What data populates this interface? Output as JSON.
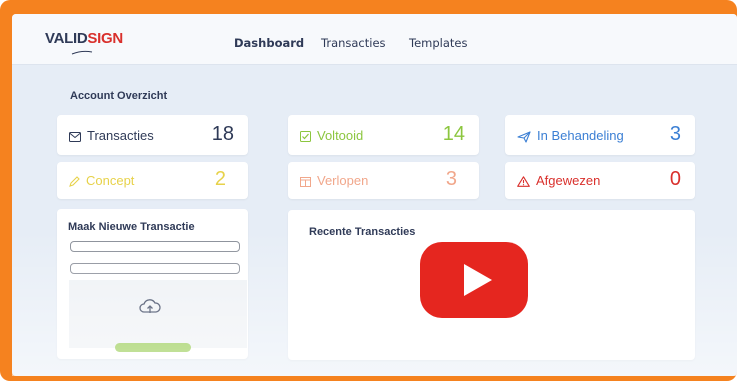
{
  "app": {
    "logo_left": "VALID",
    "logo_right": "SIGN"
  },
  "nav": {
    "items": [
      {
        "label": "Dashboard",
        "active": true
      },
      {
        "label": "Transacties",
        "active": false
      },
      {
        "label": "Templates",
        "active": false
      }
    ]
  },
  "overview": {
    "title": "Account Overzicht",
    "stats": [
      {
        "label": "Transacties",
        "value": "18",
        "icon": "envelope-icon",
        "color": "#2f3a57",
        "num_color": "#2f3a57"
      },
      {
        "label": "Voltooid",
        "value": "14",
        "icon": "check-square-icon",
        "color": "#8cc63f",
        "num_color": "#8cc63f"
      },
      {
        "label": "In Behandeling",
        "value": "3",
        "icon": "send-icon",
        "color": "#3b7fd4",
        "num_color": "#3b7fd4"
      },
      {
        "label": "Concept",
        "value": "2",
        "icon": "pen-icon",
        "color": "#e7d24a",
        "num_color": "#e7d24a"
      },
      {
        "label": "Verlopen",
        "value": "3",
        "icon": "calendar-icon",
        "color": "#f1a78b",
        "num_color": "#f1a78b"
      },
      {
        "label": "Afgewezen",
        "value": "0",
        "icon": "warning-icon",
        "color": "#d9302c",
        "num_color": "#d9302c"
      }
    ]
  },
  "new_transaction": {
    "title": "Maak Nieuwe Transactie"
  },
  "recent": {
    "title": "Recente Transacties"
  },
  "colors": {
    "frame": "#f5821f",
    "background": "#e6edf6",
    "play": "#e5261f",
    "accent_green": "#8cc63f"
  }
}
